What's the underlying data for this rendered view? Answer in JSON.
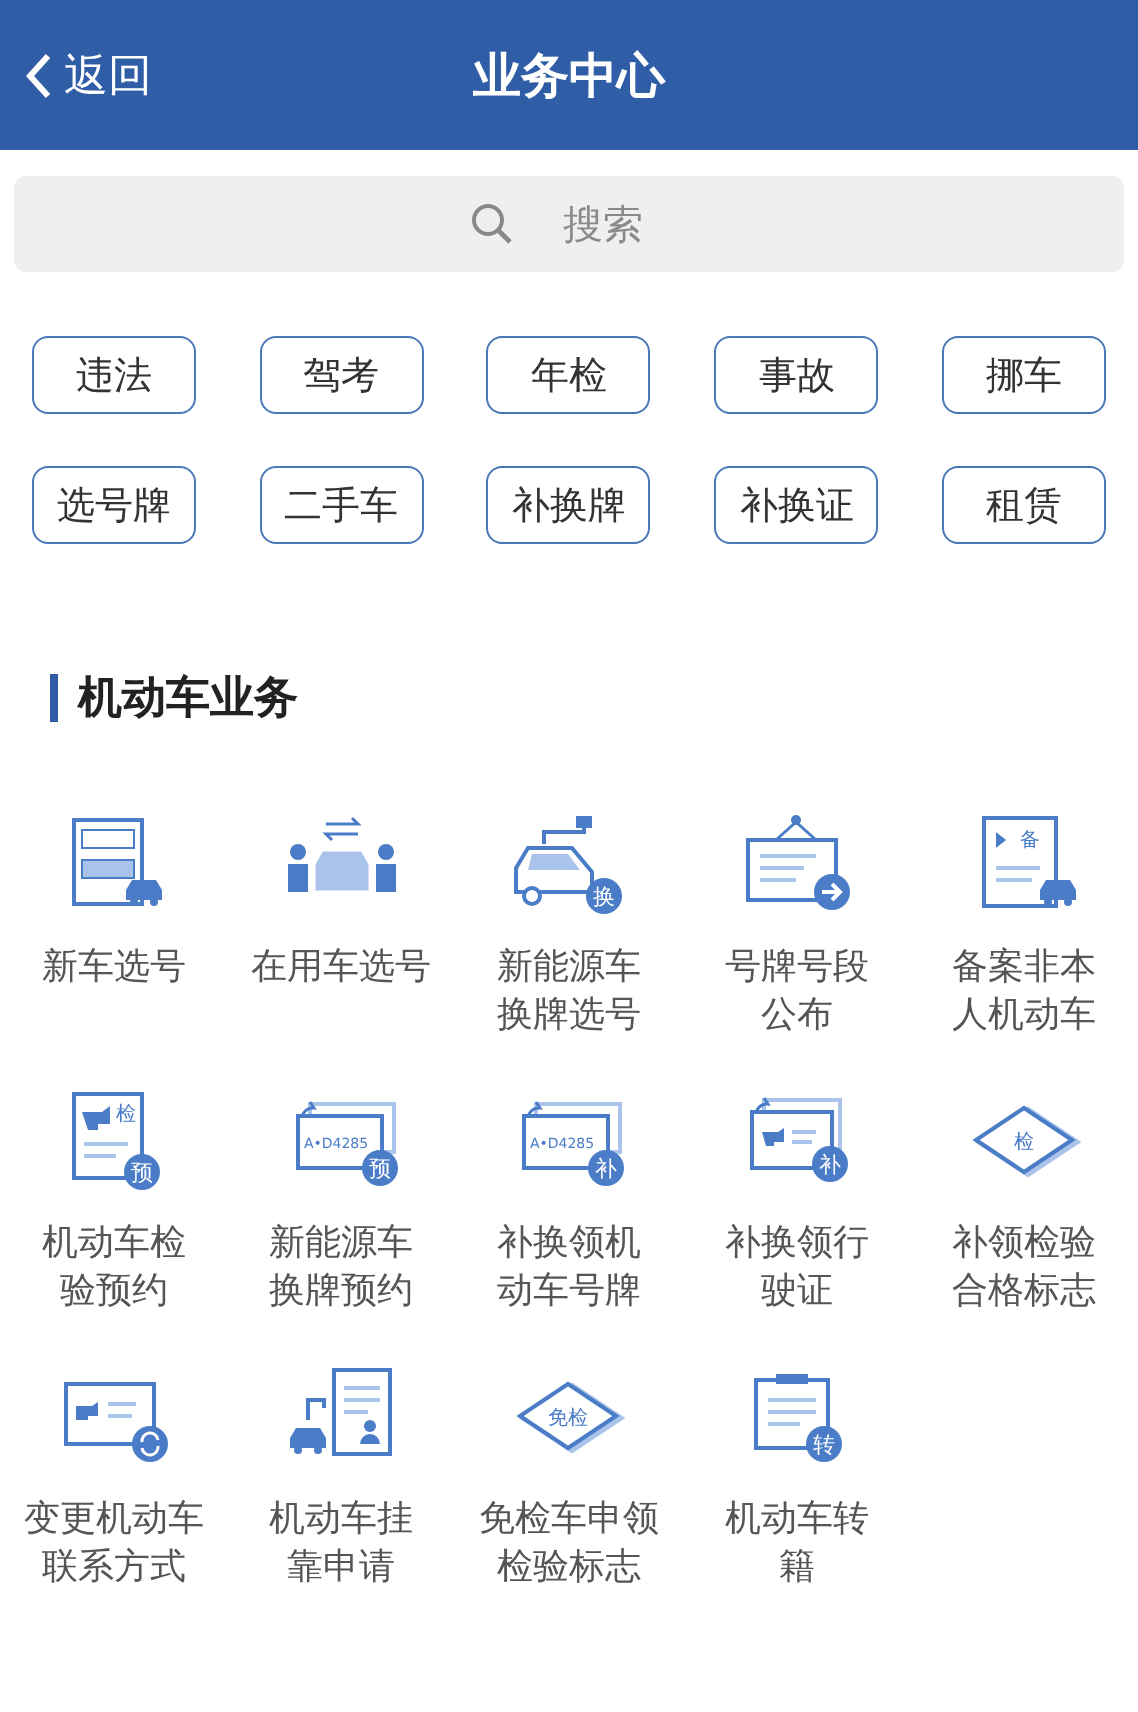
{
  "header": {
    "back": "返回",
    "title": "业务中心"
  },
  "search": {
    "placeholder": "搜索"
  },
  "tags": [
    "违法",
    "驾考",
    "年检",
    "事故",
    "挪车",
    "选号牌",
    "二手车",
    "补换牌",
    "补换证",
    "租赁"
  ],
  "section": {
    "title": "机动车业务"
  },
  "services": [
    {
      "lines": [
        "新车选号"
      ],
      "kind": "form-car"
    },
    {
      "lines": [
        "在用车选号"
      ],
      "kind": "people-car"
    },
    {
      "lines": [
        "新能源车",
        "换牌选号"
      ],
      "kind": "ev-car",
      "badge": "换"
    },
    {
      "lines": [
        "号牌号段",
        "公布"
      ],
      "kind": "notice"
    },
    {
      "lines": [
        "备案非本",
        "人机动车"
      ],
      "kind": "doc-car",
      "mark": "备"
    },
    {
      "lines": [
        "机动车检",
        "验预约"
      ],
      "kind": "doc",
      "mark": "检",
      "badge": "预"
    },
    {
      "lines": [
        "新能源车",
        "换牌预约"
      ],
      "kind": "plate",
      "plate": "A•D4285",
      "badge": "预"
    },
    {
      "lines": [
        "补换领机",
        "动车号牌"
      ],
      "kind": "plate",
      "plate": "A•D4285",
      "badge": "补"
    },
    {
      "lines": [
        "补换领行",
        "驶证"
      ],
      "kind": "card",
      "badge": "补"
    },
    {
      "lines": [
        "补领检验",
        "合格标志"
      ],
      "kind": "diamond",
      "mark": "检"
    },
    {
      "lines": [
        "变更机动车",
        "联系方式"
      ],
      "kind": "card-refresh"
    },
    {
      "lines": [
        "机动车挂",
        "靠申请"
      ],
      "kind": "tow-doc"
    },
    {
      "lines": [
        "免检车申领",
        "检验标志"
      ],
      "kind": "diamond",
      "mark": "免检"
    },
    {
      "lines": [
        "机动车转",
        "籍"
      ],
      "kind": "clipboard",
      "badge": "转"
    }
  ]
}
